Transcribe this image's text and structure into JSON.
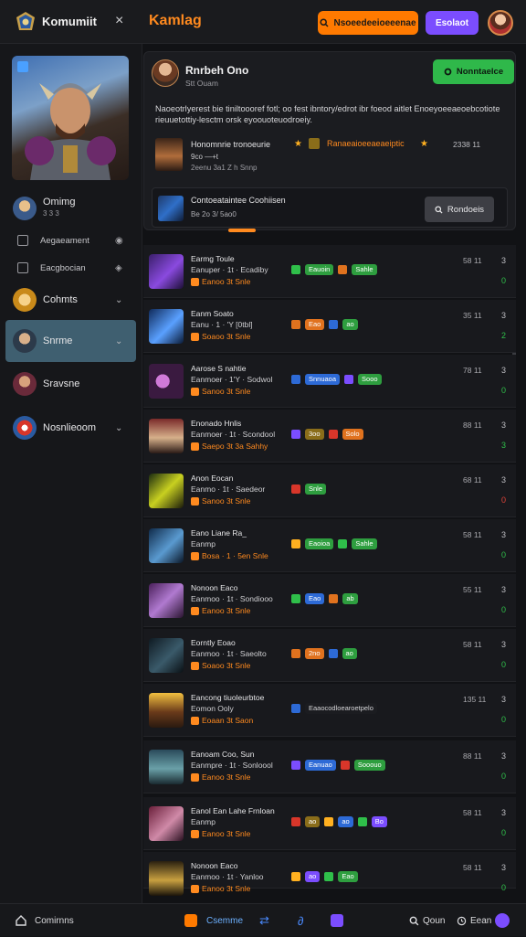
{
  "topbar": {
    "app_name": "Komumiit",
    "close_glyph": "×",
    "page_title": "Kamlag",
    "orange_button": "Nsoeedeeioeeenae",
    "purple_button": "Esolaot"
  },
  "sidebar": {
    "items": [
      {
        "label": "Omimg",
        "sub": "3 3 3"
      },
      {
        "label": "Aegaeament"
      },
      {
        "label": "Eacgbocian"
      },
      {
        "label": "Cohmts"
      },
      {
        "label": "Snrme"
      },
      {
        "label": "Sravsne"
      },
      {
        "label": "Nosnlieoom"
      }
    ]
  },
  "card": {
    "name": "Rnrbeh Ono",
    "sub": "Stt Ouam",
    "green_button": "Nonntaelce",
    "description": "Naoeotrlyerest bie tiniltoooref fotl; oo fest ibntory/edrot ibr foeod aitlet Enoeyoeeaeoebcotiote rieuuetottiy-lesctm orsk eyoouoteuodroeiy.",
    "row_a": {
      "t1": "Honomnrie tronoeurie",
      "t2": "9co —+t",
      "t3": "2eenu 3a1 Z h Snnp",
      "t4": "Ranaeaioeeaeaeiptic",
      "t5": "2338 11"
    },
    "row_b": {
      "t1": "Contoeataintee Coohiisen",
      "t2": "Be 2o 3/ 5ao0",
      "button": "Rondoeis"
    }
  },
  "list": [
    {
      "l1": "Earmg Toule",
      "l2": "Eanuper · 1t · Ecadiby",
      "l3": "Eanoo 3t Snle",
      "tags": [
        {
          "text": "Eauoin",
          "color": "#2e9e3f"
        },
        {
          "text": "Sahle",
          "color": "#2e9e3f"
        }
      ],
      "time": "58 11",
      "n1": "3",
      "n2": "0",
      "n2color": "#2fbf4a"
    },
    {
      "l1": "Eanm Soato",
      "l2": "Eanu · 1 · 'Y [0tbl]",
      "l3": "Soaoo 3t Snle",
      "tags": [
        {
          "text": "Eao",
          "color": "#e0721e"
        },
        {
          "text": "ao",
          "color": "#2e9e3f"
        }
      ],
      "time": "35 11",
      "n1": "3",
      "n2": "2",
      "n2color": "#2fbf4a"
    },
    {
      "l1": "Aarose S nahtie",
      "l2": "Eanmoer · 1'Y · Sodwol",
      "l3": "Sanoo 3t Snle",
      "tags": [
        {
          "text": "Snnuaoa",
          "color": "#2d6ad6"
        },
        {
          "text": "Sooo",
          "color": "#2e9e3f"
        }
      ],
      "time": "78 11",
      "n1": "3",
      "n2": "0",
      "n2color": "#2fbf4a"
    },
    {
      "l1": "Enonado Hnlis",
      "l2": "Eanmoer · 1t · Scondool",
      "l3": "Saepo 3t 3a Sahhy",
      "tags": [
        {
          "text": "3oo",
          "color": "#8a6d1a"
        },
        {
          "text": "Solo",
          "color": "#e0721e"
        }
      ],
      "time": "88 11",
      "n1": "3",
      "n2": "3",
      "n2color": "#2fbf4a"
    },
    {
      "l1": "Anon Eocan",
      "l2": "Eanmo · 1t · Saedeor",
      "l3": "Sanoo 3t Snle",
      "tags": [
        {
          "text": "Snle",
          "color": "#2e9e3f"
        }
      ],
      "time": "68 11",
      "n1": "3",
      "n2": "0",
      "n2color": "#e0443a"
    },
    {
      "l1": "Eano Liane Ra_",
      "l2": "Eanmp",
      "l3": "Bosa · 1 · 5en Snle",
      "tags": [
        {
          "text": "Eaoioa",
          "color": "#2e9e3f"
        },
        {
          "text": "Sahle",
          "color": "#2e9e3f"
        }
      ],
      "time": "58 11",
      "n1": "3",
      "n2": "0",
      "n2color": "#2fbf4a"
    },
    {
      "l1": "Nonoon Eaco",
      "l2": "Eanmoo · 1t · Sondiooo",
      "l3": "Eanoo 3t Snle",
      "tags": [
        {
          "text": "Eao",
          "color": "#2d6ad6"
        },
        {
          "text": "ab",
          "color": "#2e9e3f"
        }
      ],
      "time": "55 11",
      "n1": "3",
      "n2": "0",
      "n2color": "#2fbf4a"
    },
    {
      "l1": "Eorntly Eoao",
      "l2": "Eanmoo · 1t · Saeolto",
      "l3": "Soaoo 3t Snle",
      "tags": [
        {
          "text": "2no",
          "color": "#e0721e"
        },
        {
          "text": "ao",
          "color": "#2e9e3f"
        }
      ],
      "time": "58 11",
      "n1": "3",
      "n2": "0",
      "n2color": "#2fbf4a"
    },
    {
      "l1": "Eancong tiuoleurbtoe",
      "l2": "Eomon Ooly",
      "l3": "Eoaan 3t Saon",
      "tags": [
        {
          "text": "Eaaocodloearoetpelo",
          "color": "#1b1c20"
        }
      ],
      "time": "135 11",
      "n1": "3",
      "n2": "0",
      "n2color": "#2fbf4a"
    },
    {
      "l1": "Eanoam Coo, Sun",
      "l2": "Eanmpre · 1t · Sonloool",
      "l3": "Eanoo 3t Snle",
      "tags": [
        {
          "text": "Eanuao",
          "color": "#2d6ad6"
        },
        {
          "text": "Sooouo",
          "color": "#2e9e3f"
        }
      ],
      "time": "88 11",
      "n1": "3",
      "n2": "0",
      "n2color": "#2fbf4a"
    },
    {
      "l1": "Eanol Ean Lahe Frnloan",
      "l2": "Eanmp",
      "l3": "Eanoo 3t Snle",
      "tags": [
        {
          "text": "ao",
          "color": "#8a6d1a"
        },
        {
          "text": "ao",
          "color": "#2d6ad6"
        },
        {
          "text": "Bo",
          "color": "#7b4dff"
        }
      ],
      "time": "58 11",
      "n1": "3",
      "n2": "0",
      "n2color": "#2fbf4a"
    },
    {
      "l1": "Nonoon Eaco",
      "l2": "Eanmoo · 1t · Yanloo",
      "l3": "Eanoo 3t Snle",
      "tags": [
        {
          "text": "ao",
          "color": "#7b4dff"
        },
        {
          "text": "Eao",
          "color": "#2e9e3f"
        }
      ],
      "time": "58 11",
      "n1": "3",
      "n2": "0",
      "n2color": "#2fbf4a"
    }
  ],
  "bottombar": {
    "left": "Comirnns",
    "center": "Csemme",
    "right1": "Qoun",
    "right2": "Eean"
  },
  "colors": {
    "accent": "#ff8a1f",
    "purple": "#7b4dff",
    "green": "#2fb84a"
  }
}
